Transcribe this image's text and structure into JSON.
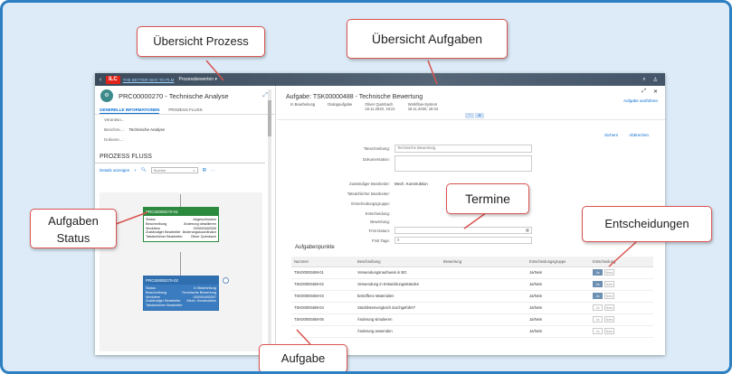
{
  "callouts": {
    "uebersicht_prozess": "Übersicht Prozess",
    "uebersicht_aufgaben": "Übersicht Aufgaben",
    "aufgaben_status": "Aufgaben\nStatus",
    "termine": "Termine",
    "entscheidungen": "Entscheidungen",
    "aufgabe": "Aufgabe"
  },
  "shellbar": {
    "logo": "ILC",
    "tagline": "THE BETTER WAY TO PLM",
    "title": "Prozessbewerten ▾",
    "search_icon": "search-icon",
    "user_icon": "user-icon"
  },
  "left": {
    "avatar": "⚙",
    "title": "PRC00000270 - Technische Analyse",
    "tabs": [
      "GENERELLE INFORMATIONEN",
      "PROZESS FLUSS"
    ],
    "fields": [
      {
        "label": "Verantwo...",
        "value": ""
      },
      {
        "label": "Beschrei...:",
        "value": "Technische Analyse"
      },
      {
        "label": "Dokume...:",
        "value": ""
      }
    ],
    "section_title": "PROZESS FLUSS",
    "toolbar": {
      "details": "Details anzeigen",
      "add": "+",
      "search_placeholder": "Suchen",
      "more": "···"
    },
    "node1": {
      "id": "PRC00000270-01",
      "rows": [
        {
          "k": "Status",
          "v": "Abgeschlossen"
        },
        {
          "k": "Beschreibung",
          "v": "Änderung detaillieren"
        },
        {
          "k": "Workitem",
          "v": "000000483305"
        },
        {
          "k": "Zuständiger Bearbeiter",
          "v": "Änderungskoordinator"
        },
        {
          "k": "Tatsächlicher Bearbeiter",
          "v": "Oliver Quimbach"
        }
      ]
    },
    "node2": {
      "id": "PRC00000270-02",
      "rows": [
        {
          "k": "Status",
          "v": "In Bearbeitung"
        },
        {
          "k": "Beschreibung",
          "v": "Technische Bewertung"
        },
        {
          "k": "Workitem",
          "v": "000000483307"
        },
        {
          "k": "Zuständiger Bearbeiter",
          "v": "Mech. Konstruktion"
        },
        {
          "k": "Tatsächlicher Bearbeiter",
          "v": ""
        }
      ]
    }
  },
  "right": {
    "title": "Aufgabe: TSK00000488 - Technische Bewertung",
    "action_link": "Aufgabe ausführen",
    "meta": [
      {
        "a": "In Bearbeitung",
        "b": ""
      },
      {
        "a": "Dialogaufgabe",
        "b": ""
      },
      {
        "a": "Oliver Quimbach",
        "b": "18.11.2020, 18:21"
      },
      {
        "a": "Workflow-System",
        "b": "18.11.2020, 18:34"
      }
    ],
    "save": "Sichern",
    "cancel": "Abbrechen",
    "form": {
      "beschreibung_label": "*Beschreibung:",
      "beschreibung_value": "Technische Bewertung",
      "dokumentation_label": "Dokumentation:",
      "zust_label": "Zuständiger Bearbeiter:",
      "zust_value": "Mech. Konstruktion",
      "tats_label": "Tatsächlicher Bearbeiter:",
      "gruppe_label": "Entscheidungsgruppe:",
      "entsch_label": "Entscheidung:",
      "bewertung_label": "Bewertung:",
      "frist_datum_label": "Frist Datum:",
      "frist_tage_label": "Frist Tage:",
      "frist_tage_value": "0"
    },
    "table": {
      "title": "Aufgabenpunkte",
      "headers": [
        "Nummer",
        "Beschreibung",
        "Bewertung",
        "Entscheidungsgruppe",
        "Entscheidung"
      ],
      "rows": [
        {
          "nr": "TSK00000488-01",
          "desc": "Verwendungsnachweis in BG",
          "grp": "Ja/Nein",
          "yes": "Ja",
          "no": "Nein",
          "on": true
        },
        {
          "nr": "TSK00000488-02",
          "desc": "Verwendung in Entwicklungsständen",
          "grp": "Ja/Nein",
          "yes": "Ja",
          "no": "Nein",
          "on": true
        },
        {
          "nr": "TSK00000488-03",
          "desc": "betroffene Materialien",
          "grp": "Ja/Nein",
          "yes": "Ja",
          "no": "Nein",
          "on": true
        },
        {
          "nr": "TSK00000488-04",
          "desc": "Stücklistenvergleich durchgeführt?",
          "grp": "Ja/Nein",
          "yes": "Ja",
          "no": "Nein",
          "on": false
        },
        {
          "nr": "TSK00000488-05",
          "desc": "Änderung simulieren",
          "grp": "Ja/Nein",
          "yes": "Ja",
          "no": "Nein",
          "on": false
        },
        {
          "nr": "",
          "desc": "Änderung anwenden",
          "grp": "Ja/Nein",
          "yes": "Ja",
          "no": "Nein",
          "on": false
        }
      ]
    }
  },
  "colors": {
    "frame": "#2d7fc1",
    "background": "#dcebf7",
    "callout_border": "#d9534f",
    "node_done": "#2b8a3e",
    "node_active": "#3b7bbf",
    "brand": "#e2231a"
  }
}
